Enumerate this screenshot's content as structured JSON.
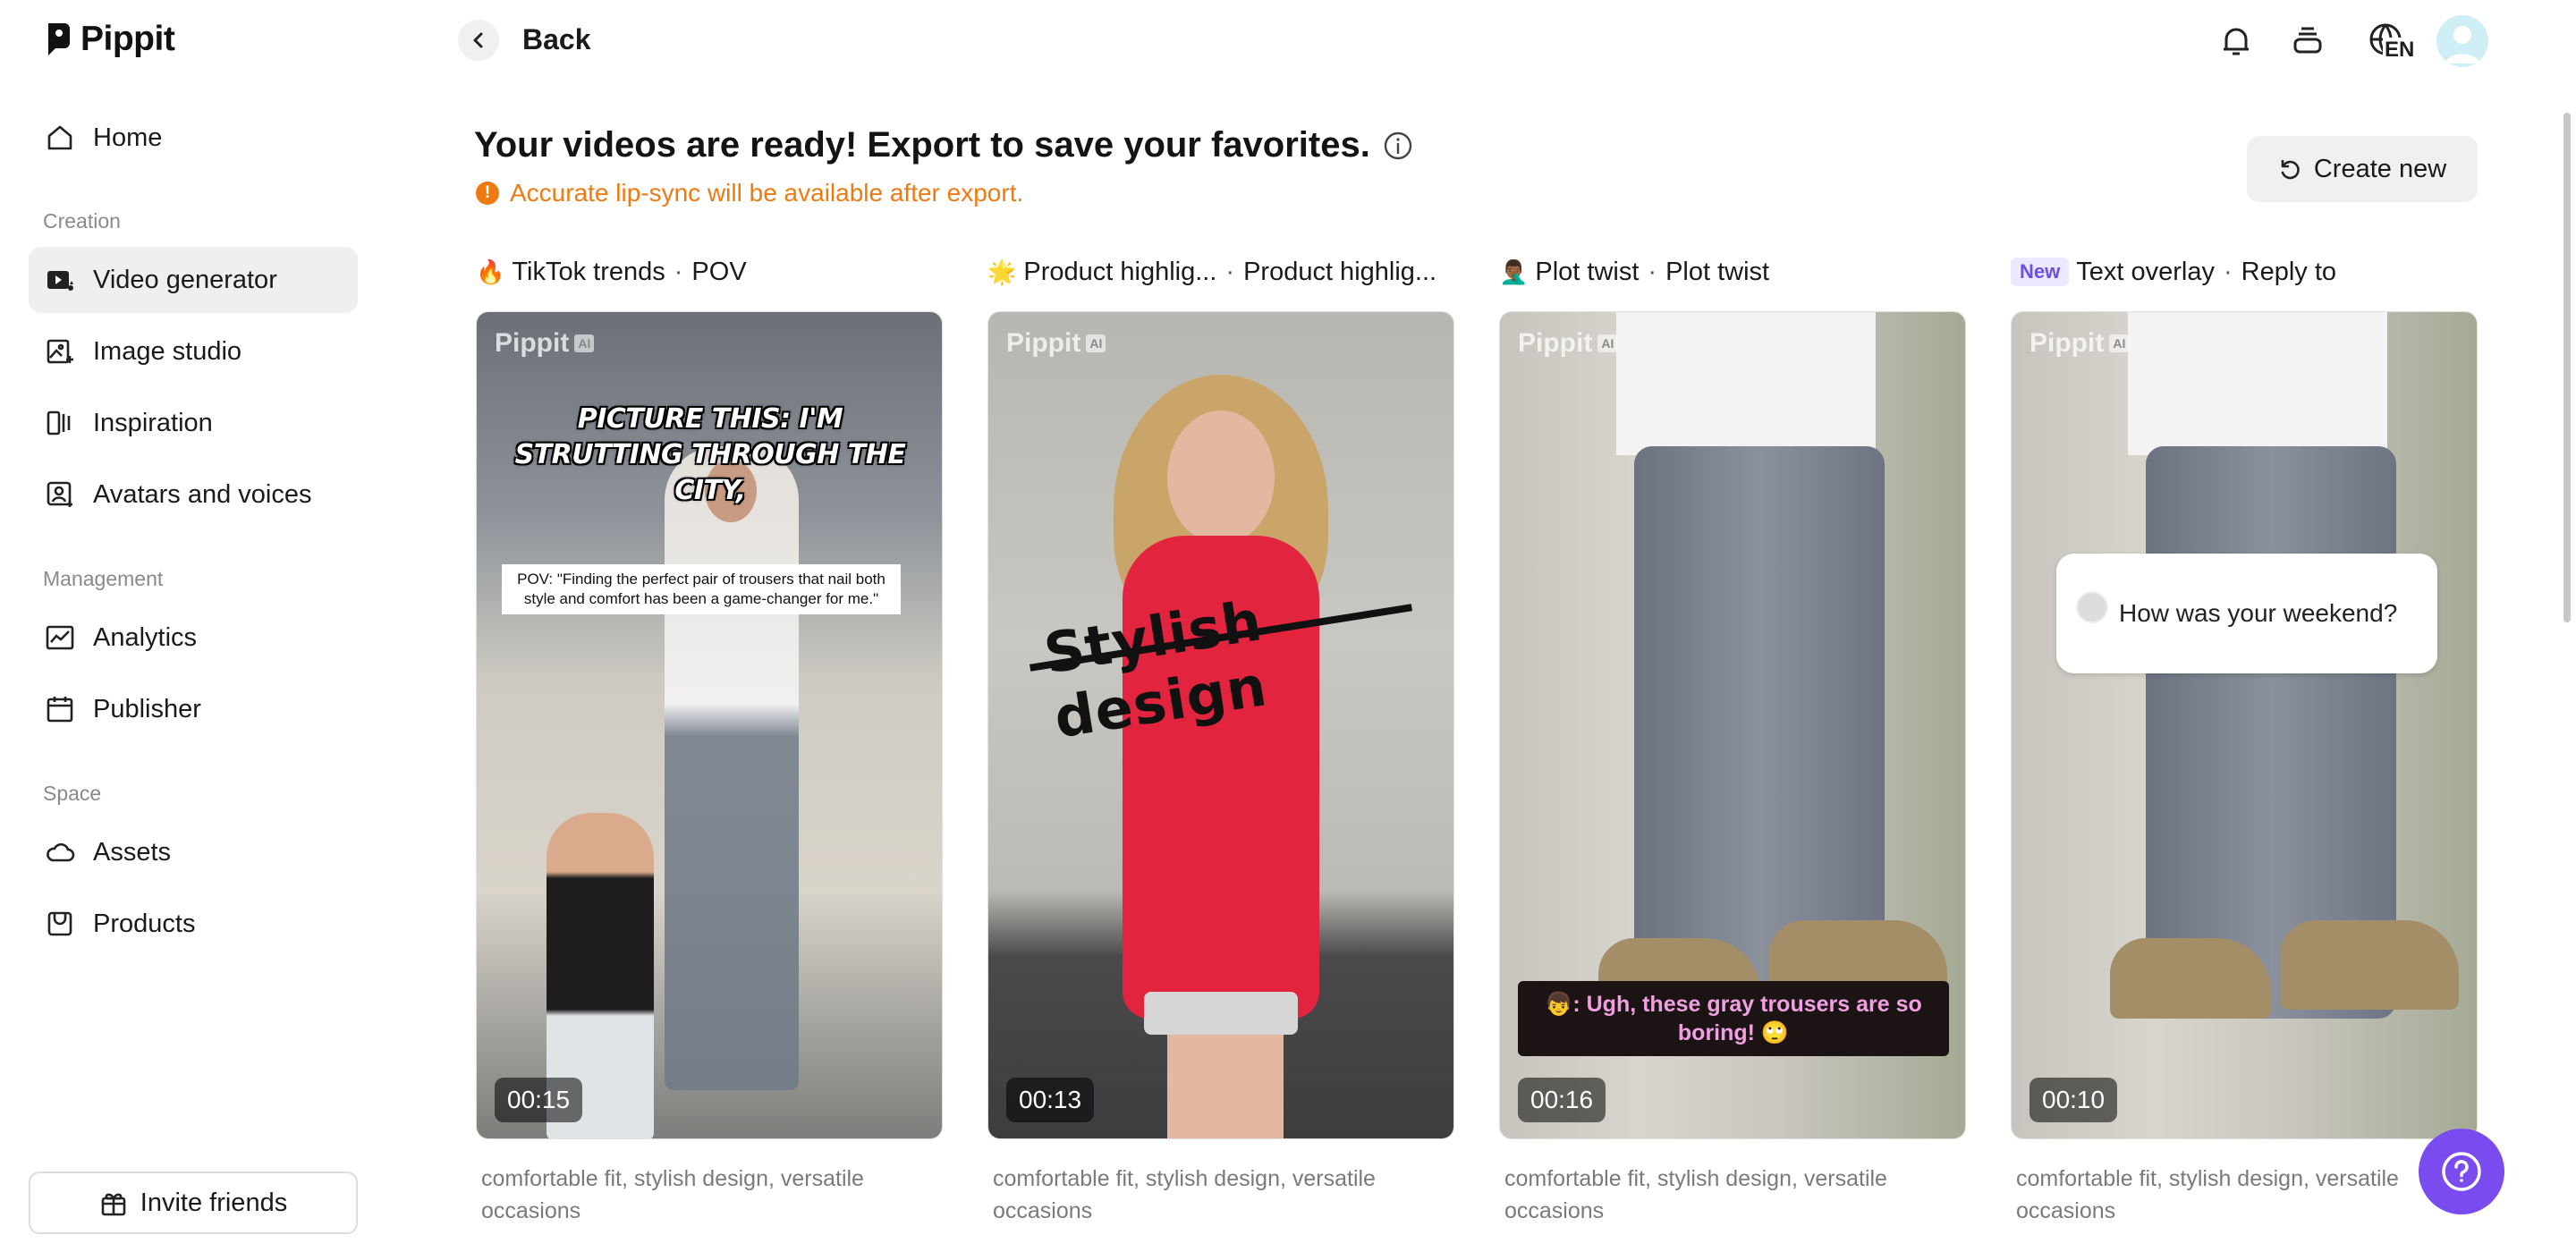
{
  "app": {
    "name": "Pippit"
  },
  "sidebar": {
    "items_top": [
      {
        "label": "Home",
        "icon": "home-icon"
      }
    ],
    "sections": [
      {
        "label": "Creation",
        "items": [
          {
            "label": "Video generator",
            "icon": "video-generator-icon",
            "active": true
          },
          {
            "label": "Image studio",
            "icon": "image-studio-icon"
          },
          {
            "label": "Inspiration",
            "icon": "inspiration-icon"
          },
          {
            "label": "Avatars and voices",
            "icon": "avatar-icon"
          }
        ]
      },
      {
        "label": "Management",
        "items": [
          {
            "label": "Analytics",
            "icon": "analytics-icon"
          },
          {
            "label": "Publisher",
            "icon": "calendar-icon"
          }
        ]
      },
      {
        "label": "Space",
        "items": [
          {
            "label": "Assets",
            "icon": "cloud-icon"
          },
          {
            "label": "Products",
            "icon": "products-icon"
          }
        ]
      }
    ],
    "invite_label": "Invite friends"
  },
  "topbar": {
    "back_label": "Back",
    "language": "EN"
  },
  "header": {
    "title": "Your videos are ready! Export to save your favorites.",
    "notice": "Accurate lip-sync will be available after export.",
    "create_new_label": "Create new"
  },
  "cards": [
    {
      "emoji": "🔥",
      "title_a": "TikTok trends",
      "title_b": "POV",
      "duration": "00:15",
      "description": "comfortable fit, stylish design, versatile occasions",
      "caption_main": "PICTURE THIS: I'M STRUTTING THROUGH THE CITY,",
      "caption_sub": "POV: \"Finding the perfect pair of trousers that nail both style and comfort has been a game-changer for me.\""
    },
    {
      "emoji": "🌟",
      "title_a": "Product highlig...",
      "title_b": "Product highlig...",
      "duration": "00:13",
      "description": "comfortable fit, stylish design, versatile occasions",
      "caption_main": "Stylish design"
    },
    {
      "emoji": "🤦🏾‍♂️",
      "title_a": "Plot twist",
      "title_b": "Plot twist",
      "duration": "00:16",
      "description": "comfortable fit, stylish design, versatile occasions",
      "caption_main": "👦: Ugh, these gray trousers are so boring! 🙄"
    },
    {
      "badge": "New",
      "title_a": "Text overlay",
      "title_b": "Reply to",
      "duration": "00:10",
      "description": "comfortable fit, stylish design, versatile occasions",
      "caption_main": "How was your weekend?"
    }
  ],
  "watermark": {
    "text": "Pippit",
    "tag": "AI"
  },
  "colors": {
    "accent": "#7a4cf0",
    "notice": "#f07a12",
    "active_bg": "#efefef"
  }
}
